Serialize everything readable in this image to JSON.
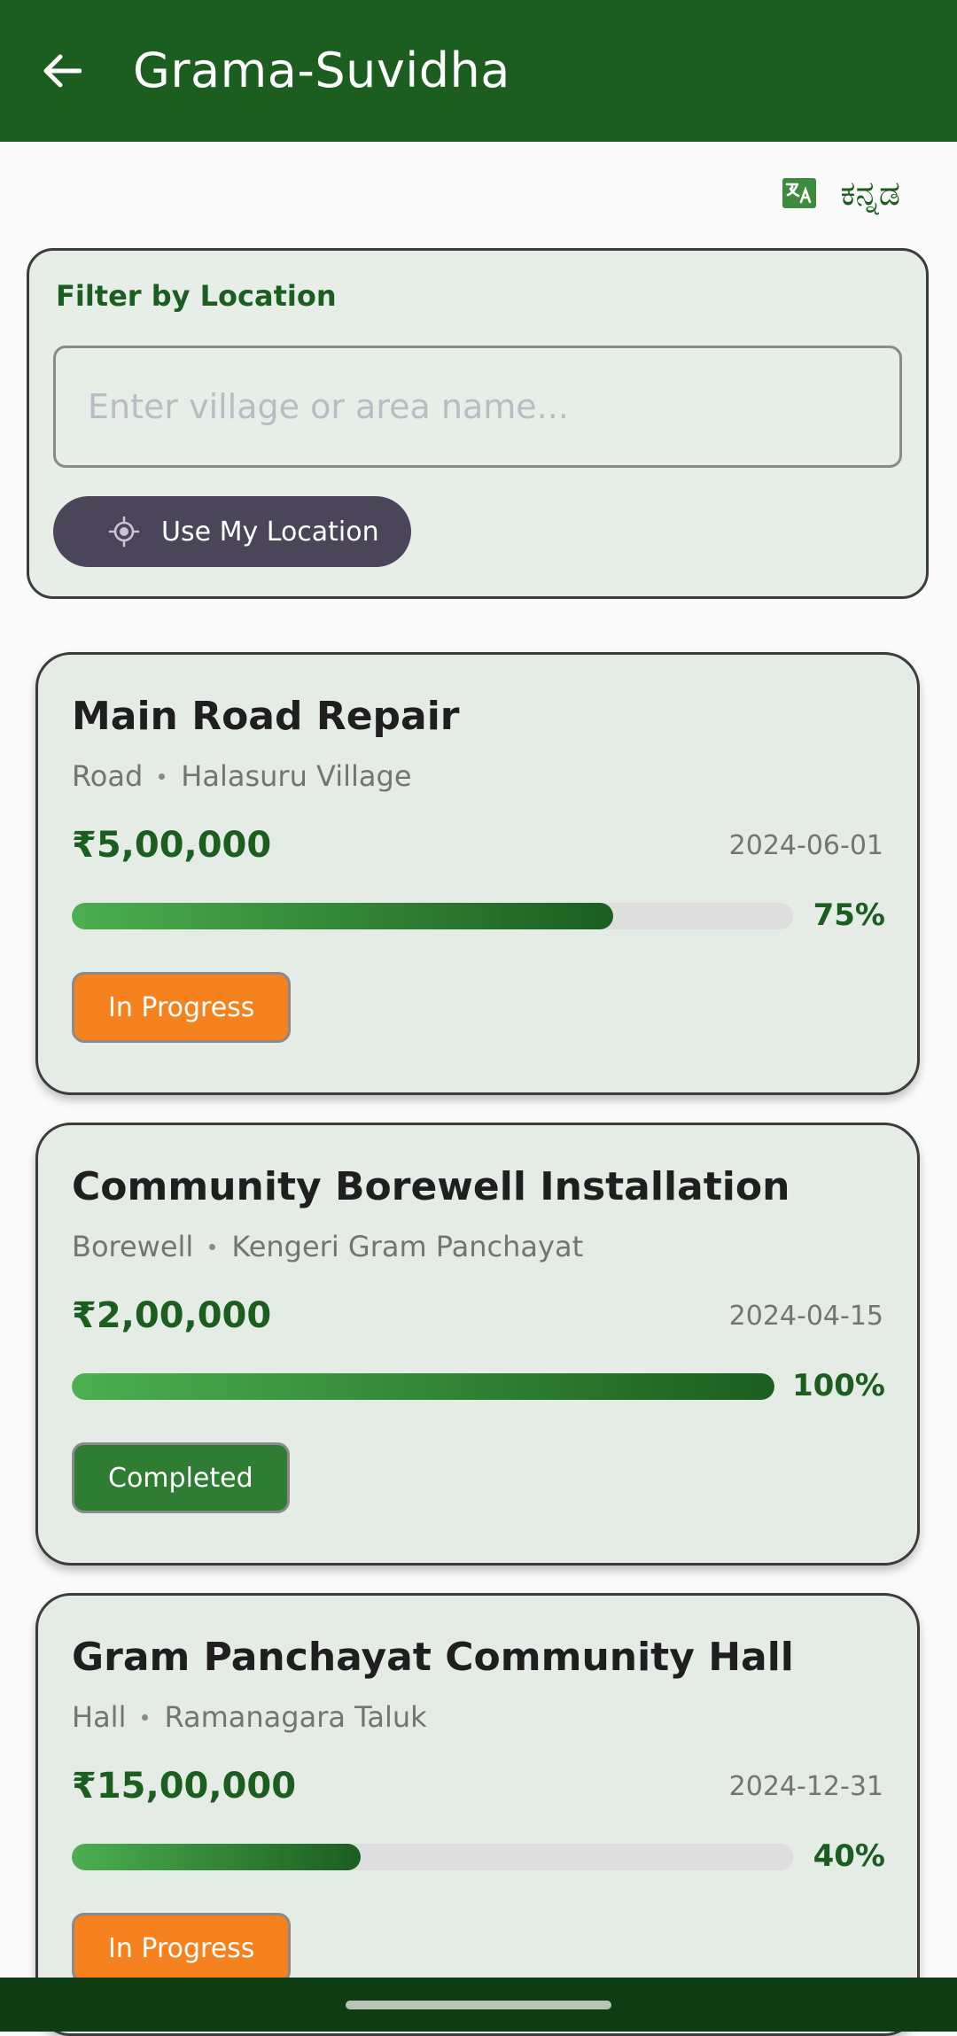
{
  "appbar": {
    "title": "Grama-Suvidha",
    "back_icon": "arrow-back-icon"
  },
  "language": {
    "icon": "translate-icon",
    "label": "ಕನ್ನಡ"
  },
  "filter": {
    "title": "Filter by Location",
    "placeholder": "Enter village or area name...",
    "value": "",
    "use_location_label": "Use My Location",
    "location_icon": "gps-target-icon"
  },
  "projects": [
    {
      "title": "Main Road Repair",
      "category": "Road",
      "location": "Halasuru Village",
      "amount": "₹5,00,000",
      "date": "2024-06-01",
      "progress_percent": 75,
      "progress_label": "75%",
      "status": "In Progress"
    },
    {
      "title": "Community Borewell Installation",
      "category": "Borewell",
      "location": "Kengeri Gram Panchayat",
      "amount": "₹2,00,000",
      "date": "2024-04-15",
      "progress_percent": 100,
      "progress_label": "100%",
      "status": "Completed"
    },
    {
      "title": "Gram Panchayat Community Hall",
      "category": "Hall",
      "location": "Ramanagara Taluk",
      "amount": "₹15,00,000",
      "date": "2024-12-31",
      "progress_percent": 40,
      "progress_label": "40%",
      "status": "In Progress"
    }
  ],
  "colors": {
    "primary": "#1b5e20",
    "status_in_progress": "#f5821f",
    "status_completed": "#2e7d32",
    "location_button": "#4a4558"
  }
}
